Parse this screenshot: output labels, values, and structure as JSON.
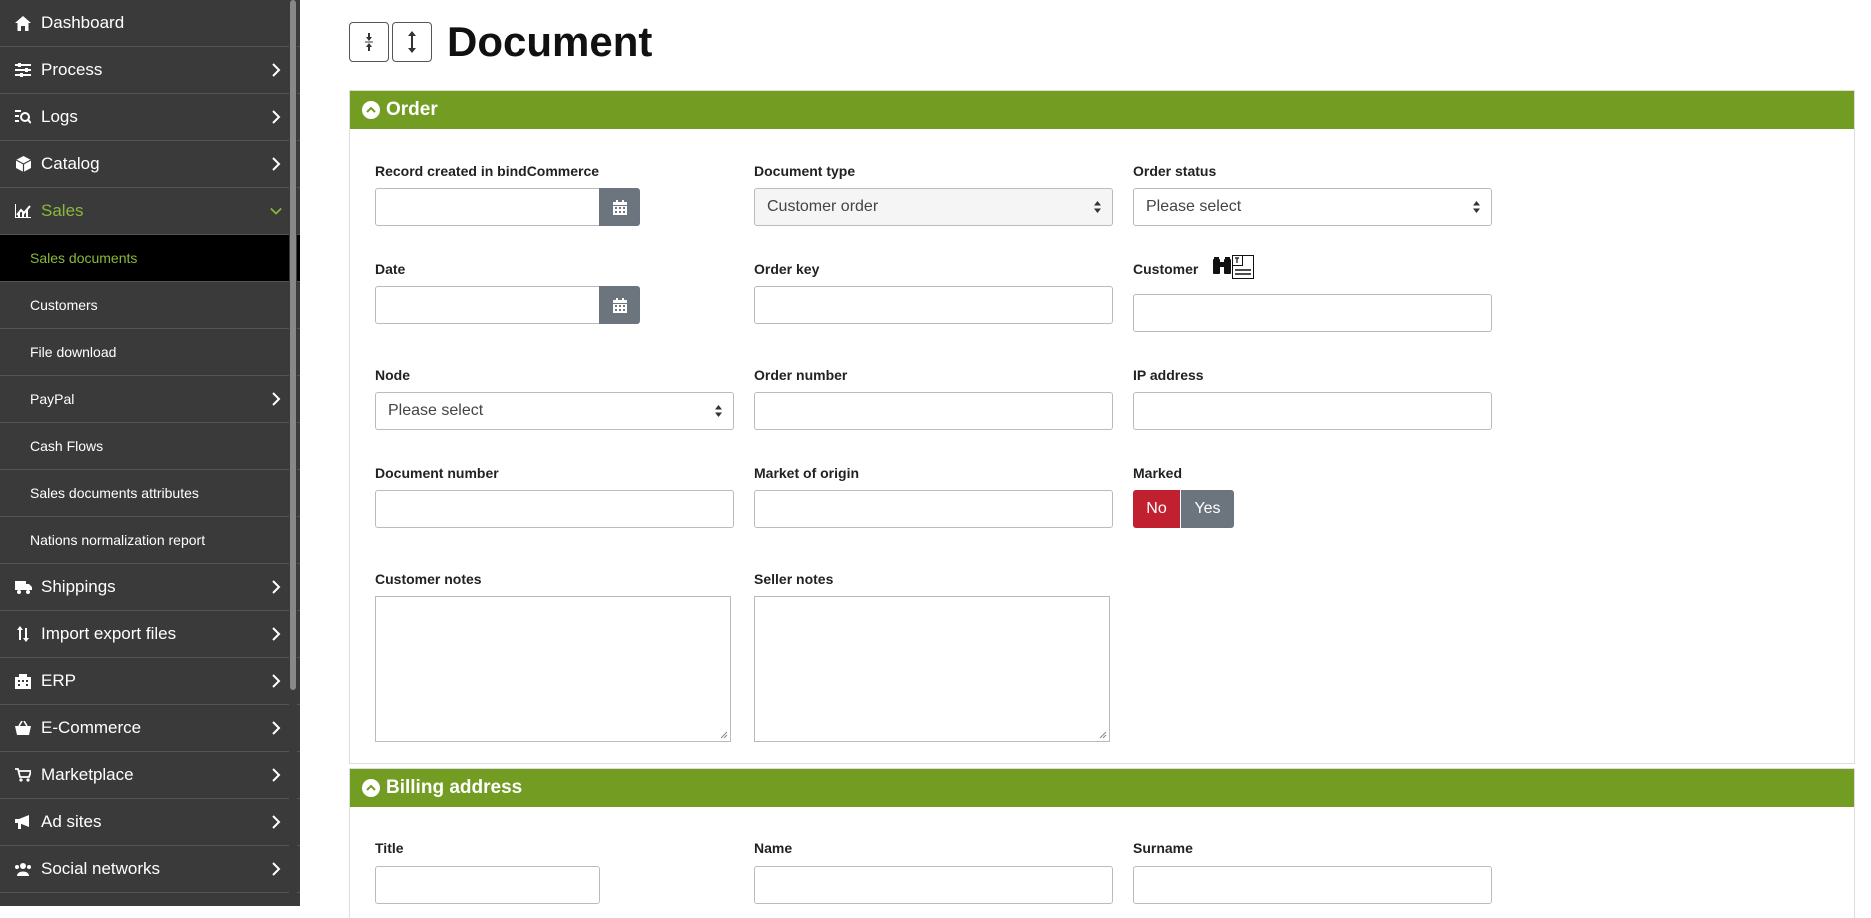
{
  "sidebar": {
    "items": [
      {
        "label": "Dashboard",
        "icon": "home-icon"
      },
      {
        "label": "Process",
        "icon": "sliders-icon"
      },
      {
        "label": "Logs",
        "icon": "log-search-icon"
      },
      {
        "label": "Catalog",
        "icon": "box-icon"
      },
      {
        "label": "Sales",
        "icon": "chart-icon"
      },
      {
        "label": "Shippings",
        "icon": "truck-icon"
      },
      {
        "label": "Import export files",
        "icon": "arrows-updown-icon"
      },
      {
        "label": "ERP",
        "icon": "building-icon"
      },
      {
        "label": "E-Commerce",
        "icon": "basket-icon"
      },
      {
        "label": "Marketplace",
        "icon": "cart-icon"
      },
      {
        "label": "Ad sites",
        "icon": "megaphone-icon"
      },
      {
        "label": "Social networks",
        "icon": "users-icon"
      }
    ],
    "sales_sub": [
      {
        "label": "Sales documents"
      },
      {
        "label": "Customers"
      },
      {
        "label": "File download"
      },
      {
        "label": "PayPal"
      },
      {
        "label": "Cash Flows"
      },
      {
        "label": "Sales documents attributes"
      },
      {
        "label": "Nations normalization report"
      }
    ],
    "accent_color": "#8ab83a"
  },
  "header": {
    "title": "Document",
    "collapse_icon": "compress-vertical-icon",
    "expand_icon": "expand-vertical-icon"
  },
  "order_panel": {
    "title": "Order",
    "header_color": "#739c22",
    "fields": {
      "record_created": {
        "label": "Record created in bindCommerce",
        "value": ""
      },
      "document_type": {
        "label": "Document type",
        "value": "Customer order"
      },
      "order_status": {
        "label": "Order status",
        "value": "Please select"
      },
      "date": {
        "label": "Date",
        "value": ""
      },
      "order_key": {
        "label": "Order key",
        "value": ""
      },
      "customer": {
        "label": "Customer",
        "value": ""
      },
      "node": {
        "label": "Node",
        "value": "Please select"
      },
      "order_number": {
        "label": "Order number",
        "value": ""
      },
      "ip_address": {
        "label": "IP address",
        "value": ""
      },
      "document_number": {
        "label": "Document number",
        "value": ""
      },
      "market_of_origin": {
        "label": "Market of origin",
        "value": ""
      },
      "marked": {
        "label": "Marked",
        "no_label": "No",
        "yes_label": "Yes",
        "selected": "No"
      },
      "customer_notes": {
        "label": "Customer notes",
        "value": ""
      },
      "seller_notes": {
        "label": "Seller notes",
        "value": ""
      }
    }
  },
  "billing_panel": {
    "title": "Billing address",
    "fields": {
      "title": {
        "label": "Title",
        "value": ""
      },
      "name": {
        "label": "Name",
        "value": ""
      },
      "surname": {
        "label": "Surname",
        "value": ""
      }
    }
  }
}
